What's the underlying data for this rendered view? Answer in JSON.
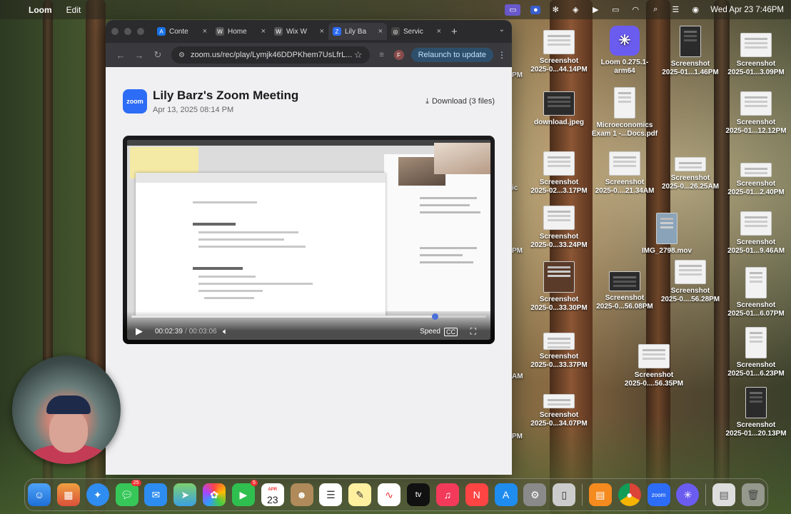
{
  "menubar": {
    "app_name": "Loom",
    "menu_edit": "Edit",
    "clock": "Wed Apr 23  7:46PM"
  },
  "browser": {
    "tabs": [
      {
        "label": "Conte",
        "favicon_color": "#1a73e8",
        "favicon_glyph": "A"
      },
      {
        "label": "Home",
        "favicon_color": "#555555",
        "favicon_glyph": "W"
      },
      {
        "label": "Wix W",
        "favicon_color": "#555555",
        "favicon_glyph": "W"
      },
      {
        "label": "Lily Ba",
        "favicon_color": "#2d6cf6",
        "favicon_glyph": "Z",
        "active": true
      },
      {
        "label": "Servic",
        "favicon_color": "#444444",
        "favicon_glyph": "◎"
      }
    ],
    "tab_close": "×",
    "new_tab": "+",
    "url": "zoom.us/rec/play/Lymjk46DDPKhem7UsLfrL...",
    "profile_initial": "F",
    "relaunch_label": "Relaunch to update"
  },
  "recording": {
    "logo_text": "zoom",
    "title": "Lily Barz's Zoom Meeting",
    "date": "Apr 13, 2025 08:14 PM",
    "download_label": "Download (3 files)",
    "current_time": "00:02:39",
    "duration": "00:03:06",
    "progress": 0.855,
    "speed_label": "Speed",
    "cc_label": "CC"
  },
  "desktop_icons": [
    {
      "label1": "Screenshot",
      "label2": "2025-0...44.14PM"
    },
    {
      "label1": "Loom 0.275.1-",
      "label2": "arm64"
    },
    {
      "label1": "Screenshot",
      "label2": "2025-01...1.46PM"
    },
    {
      "label1": "Screenshot",
      "label2": "2025-01...3.09PM"
    },
    {
      "label1": "download.jpeg",
      "label2": ""
    },
    {
      "label1": "Microeconomics",
      "label2": "Exam 1 -...Docs.pdf"
    },
    {
      "label1": "Screenshot",
      "label2": "2025-01...12.12PM"
    },
    {
      "label1": "Screenshot",
      "label2": "2025-02...3.17PM"
    },
    {
      "label1": "Screenshot",
      "label2": "2025-0....21.34AM"
    },
    {
      "label1": "Screenshot",
      "label2": "2025-0...26.25AM"
    },
    {
      "label1": "Screenshot",
      "label2": "2025-01...2.40PM"
    },
    {
      "label1": "Screenshot",
      "label2": "2025-0...33.24PM"
    },
    {
      "label1": "IMG_2798.mov",
      "label2": ""
    },
    {
      "label1": "Screenshot",
      "label2": "2025-01...9.46AM"
    },
    {
      "label1": "Screenshot",
      "label2": "2025-0...33.30PM"
    },
    {
      "label1": "Screenshot",
      "label2": "2025-0...56.08PM"
    },
    {
      "label1": "Screenshot",
      "label2": "2025-0....56.28PM"
    },
    {
      "label1": "Screenshot",
      "label2": "2025-01...6.07PM"
    },
    {
      "label1": "Screenshot",
      "label2": "2025-0...33.37PM"
    },
    {
      "label1": "Screenshot",
      "label2": "2025-0....56.35PM"
    },
    {
      "label1": "Screenshot",
      "label2": "2025-01...6.23PM"
    },
    {
      "label1": "Screenshot",
      "label2": "2025-0...34.07PM"
    },
    {
      "label1": "Screenshot",
      "label2": "2025-01...20.13PM"
    }
  ],
  "desktop_partial": [
    "PM",
    "ic",
    "AM",
    "PM",
    "PM"
  ],
  "dock": {
    "messages_badge": "25",
    "facetime_badge": "5",
    "calendar_month": "APR",
    "calendar_day": "23",
    "tv_label": "tv",
    "zoom_label": "zoom"
  }
}
